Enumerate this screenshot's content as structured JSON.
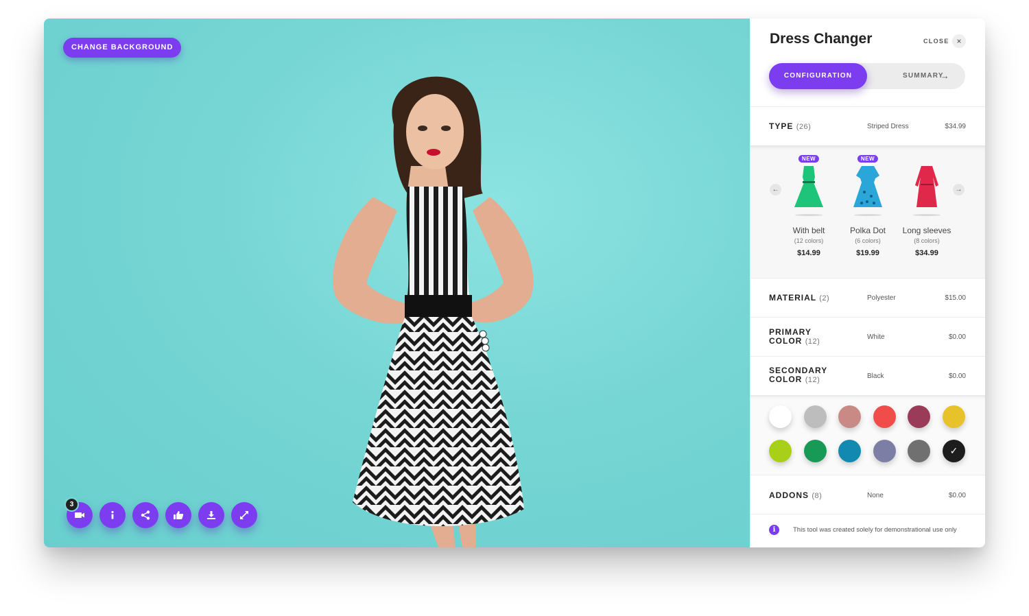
{
  "stage": {
    "change_background_label": "CHANGE BACKGROUND",
    "toolbar": [
      {
        "name": "video-icon",
        "badge": "3"
      },
      {
        "name": "info-icon"
      },
      {
        "name": "share-icon"
      },
      {
        "name": "thumbs-up-icon"
      },
      {
        "name": "download-icon"
      },
      {
        "name": "expand-icon"
      }
    ]
  },
  "panel": {
    "title": "Dress Changer",
    "close_label": "CLOSE",
    "close_icon": "×",
    "tabs": {
      "configuration": "CONFIGURATION",
      "summary": "SUMMARY",
      "summary_arrow": "→"
    },
    "type": {
      "label": "TYPE",
      "count": "(26)",
      "value": "Striped Dress",
      "price": "$34.99"
    },
    "gallery": {
      "prev": "←",
      "next": "→",
      "items": [
        {
          "badge": "NEW",
          "name": "With belt",
          "colors": "(12 colors)",
          "price": "$14.99",
          "color": "#1ec47a"
        },
        {
          "badge": "NEW",
          "name": "Polka Dot",
          "colors": "(6 colors)",
          "price": "$19.99",
          "color": "#2aa6d8"
        },
        {
          "badge": "",
          "name": "Long sleeves",
          "colors": "(8 colors)",
          "price": "$34.99",
          "color": "#e0284a"
        }
      ]
    },
    "material": {
      "label": "MATERIAL",
      "count": "(2)",
      "value": "Polyester",
      "price": "$15.00"
    },
    "primary_color": {
      "label_1": "PRIMARY",
      "label_2": "COLOR",
      "count": "(12)",
      "value": "White",
      "price": "$0.00"
    },
    "secondary_color": {
      "label_1": "SECONDARY",
      "label_2": "COLOR",
      "count": "(12)",
      "value": "Black",
      "price": "$0.00"
    },
    "swatches": [
      "#ffffff",
      "#bdbdbd",
      "#c98a86",
      "#f04d4a",
      "#9b3b5a",
      "#e8c22a",
      "#a8d018",
      "#169a55",
      "#1189b0",
      "#7d7ea6",
      "#707070",
      "#1d1d1d"
    ],
    "selected_swatch_check": "✓",
    "addons": {
      "label": "ADDONS",
      "count": "(8)",
      "value": "None",
      "price": "$0.00"
    },
    "info_icon": "i",
    "info_text": "This tool was created solely for demonstrational use only"
  },
  "colors": {
    "accent": "#7c3cf0",
    "stage_bg": "#76d6d4"
  }
}
